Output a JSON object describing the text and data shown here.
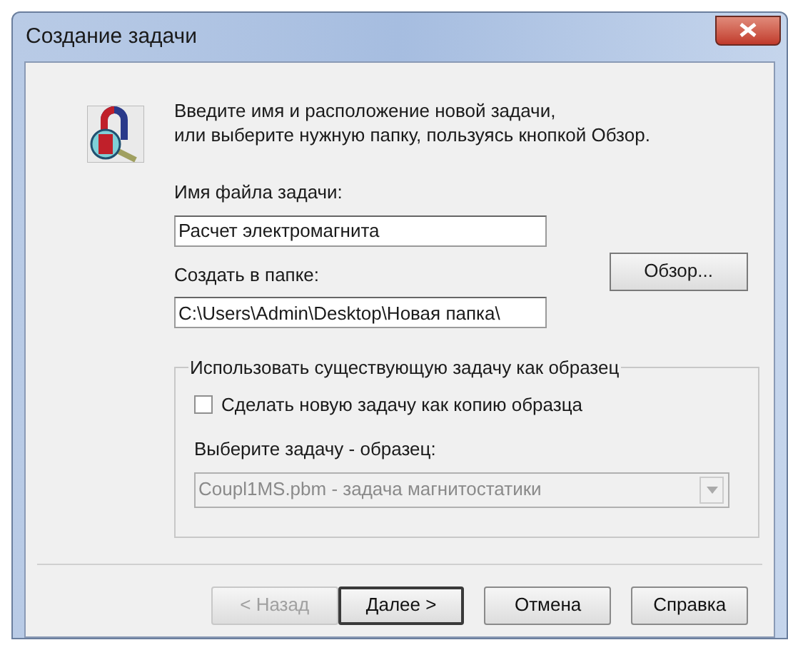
{
  "window": {
    "title": "Создание задачи"
  },
  "intro": "Введите имя и расположение новой задачи,\nили выберите нужную папку, пользуясь кнопкой Обзор.",
  "file_name": {
    "label": "Имя файла задачи:",
    "value": "Расчет электромагнита"
  },
  "folder": {
    "label": "Создать в папке:",
    "value": "C:\\Users\\Admin\\Desktop\\Новая папка\\"
  },
  "browse_button": "Обзор...",
  "template_group": {
    "title": "Использовать существующую задачу как образец",
    "checkbox": {
      "label": "Сделать новую задачу как копию образца",
      "checked": false
    },
    "select_label": "Выберите задачу - образец:",
    "select": {
      "value": "Coupl1MS.pbm -  задача магнитостатики",
      "disabled": true
    }
  },
  "buttons": [
    {
      "label": "< Назад",
      "disabled": true,
      "default": false
    },
    {
      "label": "Далее >",
      "disabled": false,
      "default": true
    },
    {
      "label": "Отмена",
      "disabled": false,
      "default": false
    },
    {
      "label": "Справка",
      "disabled": false,
      "default": false
    }
  ]
}
